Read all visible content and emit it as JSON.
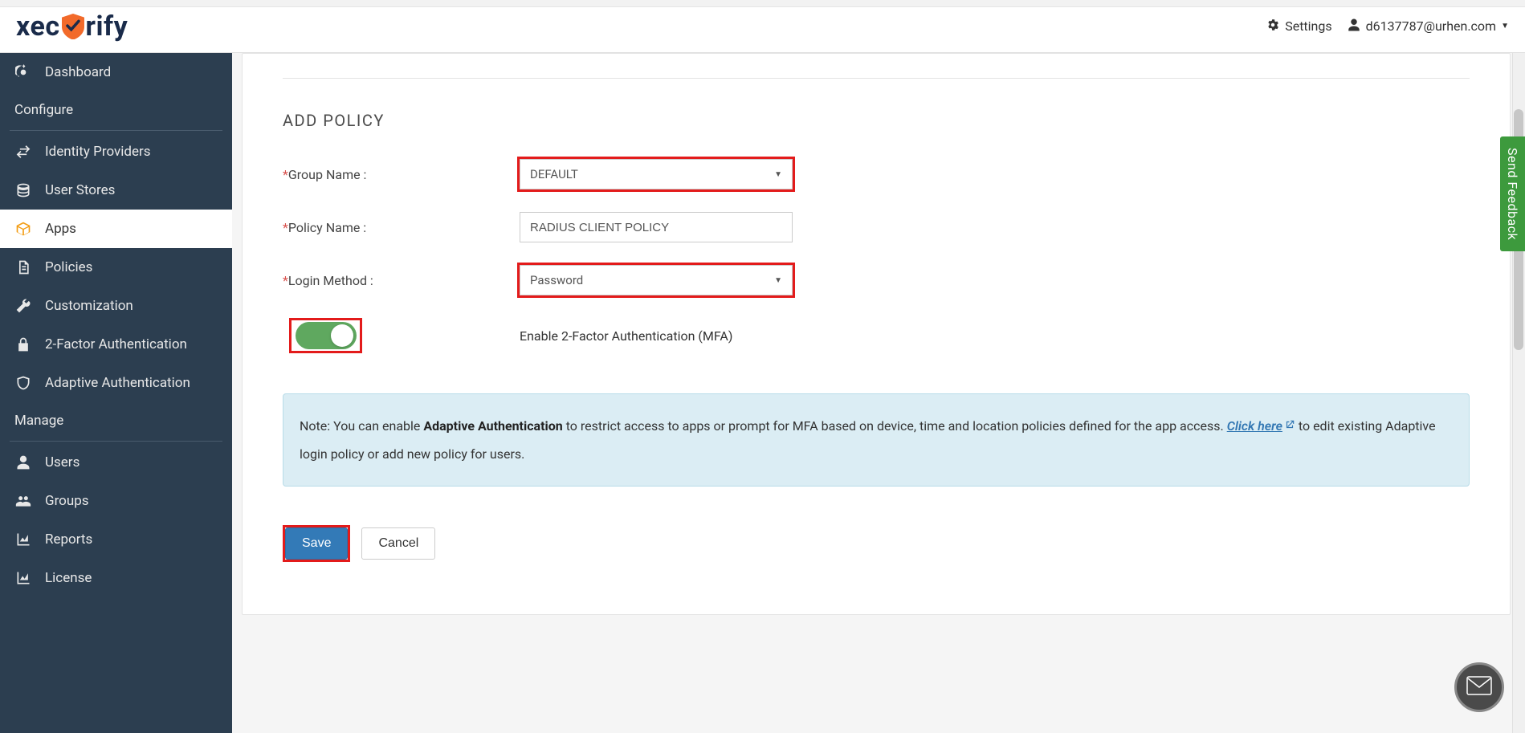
{
  "header": {
    "logo_text_pre": "xec",
    "logo_text_post": "rify",
    "settings_label": "Settings",
    "user_email": "d6137787@urhen.com"
  },
  "sidebar": {
    "items": [
      {
        "label": "Dashboard"
      },
      {
        "label": "Configure",
        "header": true
      },
      {
        "label": "Identity Providers"
      },
      {
        "label": "User Stores"
      },
      {
        "label": "Apps",
        "active": true
      },
      {
        "label": "Policies"
      },
      {
        "label": "Customization"
      },
      {
        "label": "2-Factor Authentication"
      },
      {
        "label": "Adaptive Authentication"
      },
      {
        "label": "Manage",
        "header": true
      },
      {
        "label": "Users"
      },
      {
        "label": "Groups"
      },
      {
        "label": "Reports"
      },
      {
        "label": "License"
      }
    ]
  },
  "page": {
    "title": "ADD POLICY",
    "labels": {
      "group_name": "Group Name :",
      "policy_name": "Policy Name :",
      "login_method": "Login Method :",
      "mfa_toggle": "Enable 2-Factor Authentication (MFA)"
    },
    "values": {
      "group_name": "DEFAULT",
      "policy_name": "RADIUS CLIENT POLICY",
      "login_method": "Password"
    },
    "note": {
      "prefix": "Note: You can enable ",
      "strong": "Adaptive Authentication",
      "middle": " to restrict access to apps or prompt for MFA based on device, time and location policies defined for the app access. ",
      "link": "Click here",
      "suffix": " to edit existing Adaptive login policy or add new policy for users."
    },
    "buttons": {
      "save": "Save",
      "cancel": "Cancel"
    }
  },
  "feedback_tab": "Send Feedback"
}
